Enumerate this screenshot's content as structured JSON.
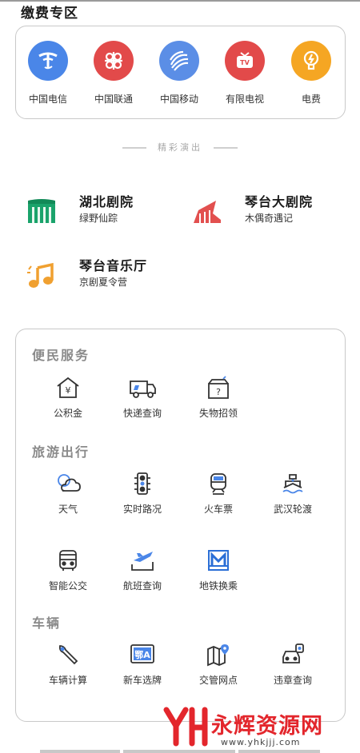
{
  "payment": {
    "title": "缴费专区",
    "items": [
      {
        "label": "中国电信",
        "icon": "china-telecom-icon",
        "color": "#4a86e8"
      },
      {
        "label": "中国联通",
        "icon": "china-unicom-icon",
        "color": "#e24a4a"
      },
      {
        "label": "中国移动",
        "icon": "china-mobile-icon",
        "color": "#5b8ee6"
      },
      {
        "label": "有限电视",
        "icon": "tv-icon",
        "color": "#e24a4a"
      },
      {
        "label": "电费",
        "icon": "electricity-icon",
        "color": "#f5a623"
      }
    ]
  },
  "shows": {
    "divider": "精彩演出",
    "items": [
      {
        "name": "湖北剧院",
        "sub": "绿野仙踪",
        "icon": "theater-building-icon",
        "color": "#1aa36b"
      },
      {
        "name": "琴台大剧院",
        "sub": "木偶奇遇记",
        "icon": "grand-theater-icon",
        "color": "#e2504f"
      },
      {
        "name": "琴台音乐厅",
        "sub": "京剧夏令营",
        "icon": "music-note-icon",
        "color": "#f0a030"
      }
    ]
  },
  "services": {
    "groups": [
      {
        "title": "便民服务",
        "items": [
          {
            "label": "公积金",
            "icon": "housing-fund-icon"
          },
          {
            "label": "快递查询",
            "icon": "delivery-truck-icon"
          },
          {
            "label": "失物招领",
            "icon": "lost-found-box-icon"
          }
        ]
      },
      {
        "title": "旅游出行",
        "items": [
          {
            "label": "天气",
            "icon": "weather-cloud-icon"
          },
          {
            "label": "实时路况",
            "icon": "traffic-light-icon"
          },
          {
            "label": "火车票",
            "icon": "train-icon"
          },
          {
            "label": "武汉轮渡",
            "icon": "ferry-icon"
          },
          {
            "label": "智能公交",
            "icon": "bus-icon"
          },
          {
            "label": "航班查询",
            "icon": "airplane-icon"
          },
          {
            "label": "地铁换乘",
            "icon": "metro-icon"
          }
        ]
      },
      {
        "title": "车辆",
        "items": [
          {
            "label": "车辆计算",
            "icon": "wrench-icon"
          },
          {
            "label": "新车选牌",
            "icon": "license-plate-icon"
          },
          {
            "label": "交管网点",
            "icon": "map-pin-icon"
          },
          {
            "label": "违章查询",
            "icon": "car-violation-icon"
          }
        ]
      }
    ],
    "plate_text": "鄂A"
  },
  "watermark": {
    "text": "永辉资源网",
    "url": "www.yhkjjj.com"
  }
}
